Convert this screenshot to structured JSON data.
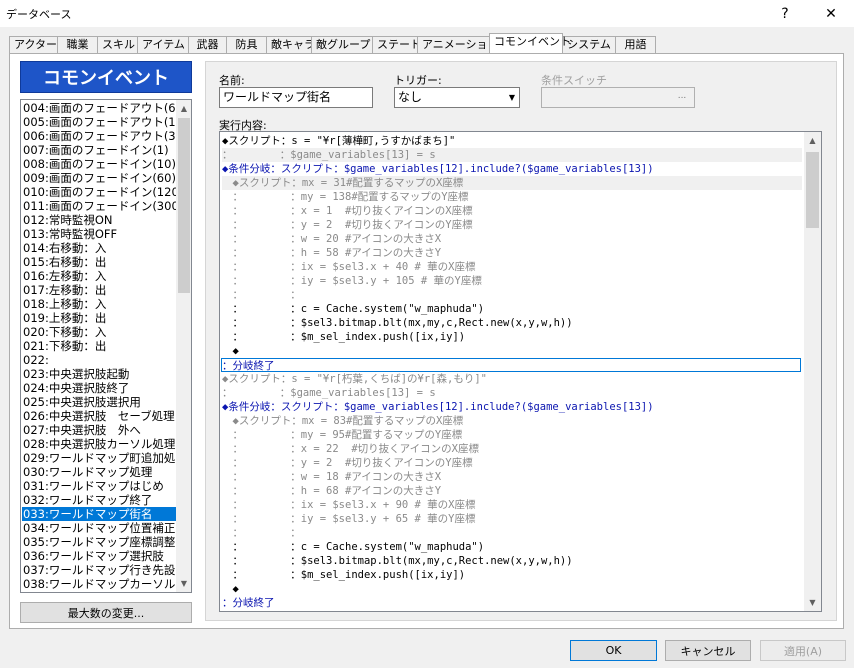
{
  "window": {
    "title": "データベース",
    "help_glyph": "?",
    "close_glyph": "✕"
  },
  "tabs": [
    "アクター",
    "職業",
    "スキル",
    "アイテム",
    "武器",
    "防具",
    "敵キャラ",
    "敵グループ",
    "ステート",
    "アニメーション",
    "コモンイベント",
    "システム",
    "用語"
  ],
  "active_tab": "コモンイベント",
  "list_header": "コモンイベント",
  "list_items": [
    "004:画面のフェードアウト(6",
    "005:画面のフェードアウト(1",
    "006:画面のフェードアウト(3",
    "007:画面のフェードイン(1)",
    "008:画面のフェードイン(10)",
    "009:画面のフェードイン(60)",
    "010:画面のフェードイン(120",
    "011:画面のフェードイン(300",
    "012:常時監視ON",
    "013:常時監視OFF",
    "014:右移動：入",
    "015:右移動：出",
    "016:左移動：入",
    "017:左移動：出",
    "018:上移動：入",
    "019:上移動：出",
    "020:下移動：入",
    "021:下移動：出",
    "022:",
    "023:中央選択肢起動",
    "024:中央選択肢終了",
    "025:中央選択肢選択用",
    "026:中央選択肢　セーブ処理",
    "027:中央選択肢　外へ",
    "028:中央選択肢カーソル処理",
    "029:ワールドマップ町追加処",
    "030:ワールドマップ処理",
    "031:ワールドマップはじめ",
    "032:ワールドマップ終了",
    "033:ワールドマップ街名",
    "034:ワールドマップ位置補正",
    "035:ワールドマップ座標調整",
    "036:ワールドマップ選択肢",
    "037:ワールドマップ行き先設",
    "038:ワールドマップカーソル"
  ],
  "selected_index": 29,
  "max_button": "最大数の変更...",
  "form": {
    "name_label": "名前:",
    "name_value": "ワールドマップ街名",
    "trigger_label": "トリガー:",
    "trigger_value": "なし",
    "switch_label": "条件スイッチ",
    "switch_button": "...",
    "contents_label": "実行内容:"
  },
  "commands": [
    {
      "text": "◆スクリプト：s = \"¥r[薄樺町,うすかばまち]\"",
      "style": "normal",
      "shade": false
    },
    {
      "text": "：　　　　　：$game_variables[13] = s",
      "style": "gray",
      "shade": true
    },
    {
      "text": "◆条件分岐：スクリプト：$game_variables[12].include?($game_variables[13])",
      "style": "blue",
      "shade": false
    },
    {
      "text": "　◆スクリプト：mx = 31#配置するマップのX座標",
      "style": "gray",
      "shade": true
    },
    {
      "text": "　：　　　　　：my = 138#配置するマップのY座標",
      "style": "gray",
      "shade": false
    },
    {
      "text": "　：　　　　　：x = 1  #切り抜くアイコンのX座標",
      "style": "gray",
      "shade": false
    },
    {
      "text": "　：　　　　　：y = 2  #切り抜くアイコンのY座標",
      "style": "gray",
      "shade": false
    },
    {
      "text": "　：　　　　　：w = 20 #アイコンの大きさX",
      "style": "gray",
      "shade": false
    },
    {
      "text": "　：　　　　　：h = 58 #アイコンの大きさY",
      "style": "gray",
      "shade": false
    },
    {
      "text": "　：　　　　　：ix = $sel3.x + 40 # 華のX座標",
      "style": "gray",
      "shade": false
    },
    {
      "text": "　：　　　　　：iy = $sel3.y + 105 # 華のY座標",
      "style": "gray",
      "shade": false
    },
    {
      "text": "　：　　　　　：",
      "style": "gray",
      "shade": false
    },
    {
      "text": "　：　　　　　：c = Cache.system(\"w_maphuda\")",
      "style": "normal",
      "shade": false
    },
    {
      "text": "　：　　　　　：$sel3.bitmap.blt(mx,my,c,Rect.new(x,y,w,h))",
      "style": "normal",
      "shade": false
    },
    {
      "text": "　：　　　　　：$m_sel_index.push([ix,iy])",
      "style": "normal",
      "shade": false
    },
    {
      "text": "　◆",
      "style": "normal",
      "shade": false
    },
    {
      "text": "：分岐終了",
      "style": "blue",
      "shade": false,
      "hl": true
    },
    {
      "text": "◆スクリプト：s = \"¥r[朽葉,くちば]の¥r[森,もり]\"",
      "style": "gray",
      "shade": false
    },
    {
      "text": "：　　　　　：$game_variables[13] = s",
      "style": "gray",
      "shade": false
    },
    {
      "text": "◆条件分岐：スクリプト：$game_variables[12].include?($game_variables[13])",
      "style": "blue",
      "shade": false
    },
    {
      "text": "　◆スクリプト：mx = 83#配置するマップのX座標",
      "style": "gray",
      "shade": false
    },
    {
      "text": "　：　　　　　：my = 95#配置するマップのY座標",
      "style": "gray",
      "shade": false
    },
    {
      "text": "　：　　　　　：x = 22  #切り抜くアイコンのX座標",
      "style": "gray",
      "shade": false
    },
    {
      "text": "　：　　　　　：y = 2  #切り抜くアイコンのY座標",
      "style": "gray",
      "shade": false
    },
    {
      "text": "　：　　　　　：w = 18 #アイコンの大きさX",
      "style": "gray",
      "shade": false
    },
    {
      "text": "　：　　　　　：h = 68 #アイコンの大きさY",
      "style": "gray",
      "shade": false
    },
    {
      "text": "　：　　　　　：ix = $sel3.x + 90 # 華のX座標",
      "style": "gray",
      "shade": false
    },
    {
      "text": "　：　　　　　：iy = $sel3.y + 65 # 華のY座標",
      "style": "gray",
      "shade": false
    },
    {
      "text": "　：　　　　　：",
      "style": "gray",
      "shade": false
    },
    {
      "text": "　：　　　　　：c = Cache.system(\"w_maphuda\")",
      "style": "normal",
      "shade": false
    },
    {
      "text": "　：　　　　　：$sel3.bitmap.blt(mx,my,c,Rect.new(x,y,w,h))",
      "style": "normal",
      "shade": false
    },
    {
      "text": "　：　　　　　：$m_sel_index.push([ix,iy])",
      "style": "normal",
      "shade": false
    },
    {
      "text": "　◆",
      "style": "normal",
      "shade": false
    },
    {
      "text": "：分岐終了",
      "style": "blue",
      "shade": false
    }
  ],
  "buttons": {
    "ok": "OK",
    "cancel": "キャンセル",
    "apply": "適用(A)"
  },
  "colors": {
    "list_header_bg": "#1e55c8",
    "selection": "#0078d7",
    "command_blue": "#0b15b0",
    "command_gray": "#8a8a8a"
  }
}
